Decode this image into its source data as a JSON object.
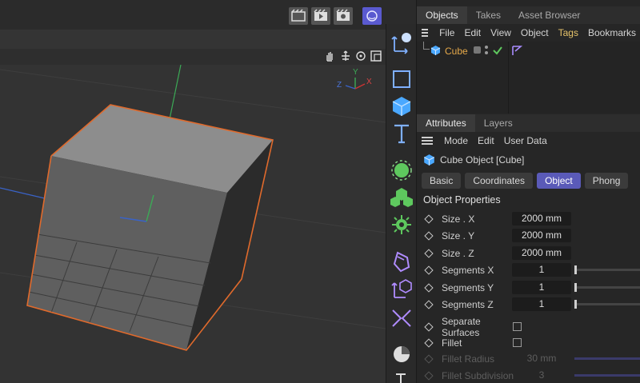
{
  "toolbar": {
    "buttons": [
      "render-view-icon",
      "render-icon",
      "render-settings-icon",
      "tool-icon"
    ]
  },
  "viewport_nav": [
    "hand-icon",
    "move-icon",
    "rotate-icon",
    "maximize-icon"
  ],
  "axis_gizmo": {
    "y": "Y",
    "z": "Z",
    "x": "X"
  },
  "objects_panel": {
    "tabs": [
      "Objects",
      "Takes",
      "Asset Browser"
    ],
    "menu": [
      "File",
      "Edit",
      "View",
      "Object",
      "Tags",
      "Bookmarks"
    ],
    "items": [
      {
        "name": "Cube"
      }
    ]
  },
  "attributes_panel": {
    "tabs": [
      "Attributes",
      "Layers"
    ],
    "menu": [
      "Mode",
      "Edit",
      "User Data"
    ],
    "object_title": "Cube Object [Cube]",
    "subtabs": [
      "Basic",
      "Coordinates",
      "Object",
      "Phong"
    ],
    "active_subtab": "Object",
    "section_title": "Object Properties",
    "properties": [
      {
        "label": "Size . X",
        "value": "2000 mm"
      },
      {
        "label": "Size . Y",
        "value": "2000 mm"
      },
      {
        "label": "Size . Z",
        "value": "2000 mm"
      },
      {
        "label": "Segments X",
        "value": "1"
      },
      {
        "label": "Segments Y",
        "value": "1"
      },
      {
        "label": "Segments Z",
        "value": "1"
      }
    ],
    "checkboxes": [
      {
        "label": "Separate Surfaces",
        "checked": false
      },
      {
        "label": "Fillet",
        "checked": false
      }
    ],
    "dim_properties": [
      {
        "label": "Fillet Radius",
        "value": "30 mm"
      },
      {
        "label": "Fillet Subdivision",
        "value": "3"
      }
    ]
  },
  "colors": {
    "accent": "#5a5ab8",
    "selection_edge": "#e06a2c",
    "tags_menu": "#e6c36a",
    "cube_label": "#e6a94a"
  }
}
